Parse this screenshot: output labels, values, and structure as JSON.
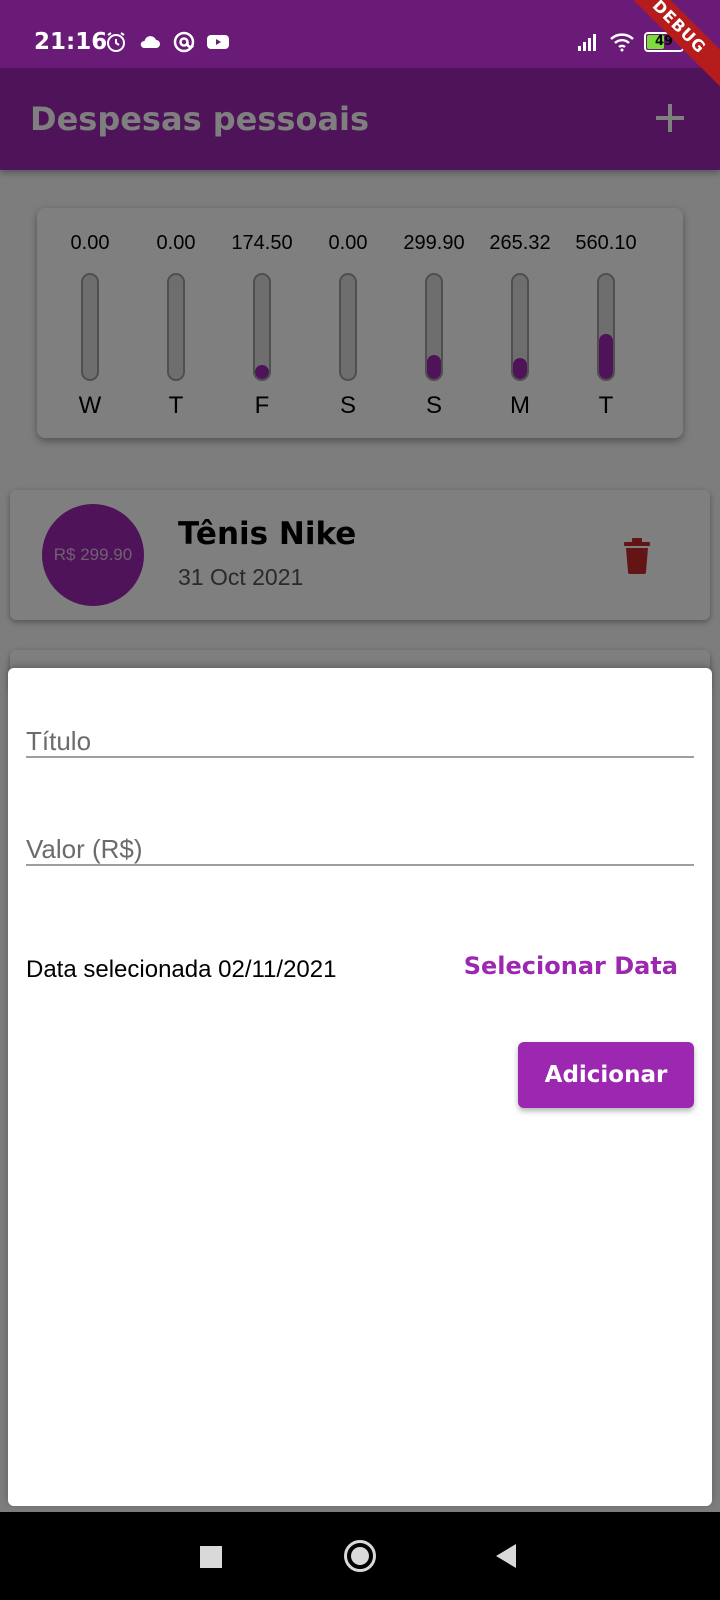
{
  "status_bar": {
    "time": "21:16",
    "battery": "49",
    "debug_banner": "DEBUG",
    "icons": [
      "alarm-icon",
      "cloud-icon",
      "at-icon",
      "youtube-icon",
      "signal-icon",
      "wifi-icon",
      "battery-icon"
    ]
  },
  "app_bar": {
    "title": "Despesas pessoais",
    "add_icon": "plus-icon"
  },
  "chart": {
    "bars": [
      {
        "day": "W",
        "value": "0.00",
        "fraction": 0.0
      },
      {
        "day": "T",
        "value": "0.00",
        "fraction": 0.0
      },
      {
        "day": "F",
        "value": "174.50",
        "fraction": 0.134
      },
      {
        "day": "S",
        "value": "0.00",
        "fraction": 0.0
      },
      {
        "day": "S",
        "value": "299.90",
        "fraction": 0.23
      },
      {
        "day": "M",
        "value": "265.32",
        "fraction": 0.203
      },
      {
        "day": "T",
        "value": "560.10",
        "fraction": 0.429
      }
    ]
  },
  "transactions": [
    {
      "amount": "R$ 299.90",
      "title": "Tênis Nike",
      "date": "31 Oct 2021",
      "delete_icon": "trash-icon"
    }
  ],
  "form": {
    "title_label": "Título",
    "title_value": "",
    "value_label": "Valor (R$)",
    "value_value": "",
    "date_text": "Data selecionada 02/11/2021",
    "select_date_label": "Selecionar Data",
    "submit_label": "Adicionar"
  },
  "colors": {
    "primary": "#9c27b0",
    "status_bar": "#6a1b78",
    "delete": "#c62828"
  },
  "nav_bar": {
    "icons": [
      "recent-apps-icon",
      "home-icon",
      "back-icon"
    ]
  }
}
